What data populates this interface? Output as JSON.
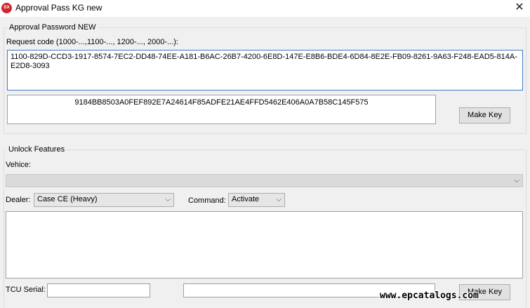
{
  "window": {
    "title": "Approval Pass KG new",
    "icon_text": "DX",
    "close_glyph": "✕"
  },
  "password_group": {
    "title": "Approval Password NEW",
    "request_label": "Request code (1000-...,1100-..., 1200-..., 2000-...):",
    "request_value": "1100-829D-CCD3-1917-8574-7EC2-DD48-74EE-A181-B6AC-26B7-4200-6E8D-147E-E8B6-BDE4-6D84-8E2E-FB09-8261-9A63-F248-EAD5-814A-E2D8-3093",
    "key_value": "9184BB8503A0FEF892E7A24614F85ADFE21AE4FFD5462E406A0A7B58C145F575",
    "make_key_label": "Make Key"
  },
  "unlock_group": {
    "title": "Unlock Features",
    "vehicle_label": "Vehice:",
    "vehicle_value": "",
    "dealer_label": "Dealer:",
    "dealer_value": "Case CE (Heavy)",
    "command_label": "Command:",
    "command_value": "Activate",
    "notes_value": "",
    "tcu_label": "TCU Serial:",
    "tcu_value": "",
    "result_value": "",
    "make_key_label": "Make Key"
  },
  "watermark": "www.epcatalogs.com",
  "icons": {
    "app": "app-logo-icon",
    "dropdown": "chevron-down-icon",
    "close": "close-icon"
  },
  "colors": {
    "focus_border": "#3d7bc9",
    "app_icon": "#d0262e"
  }
}
